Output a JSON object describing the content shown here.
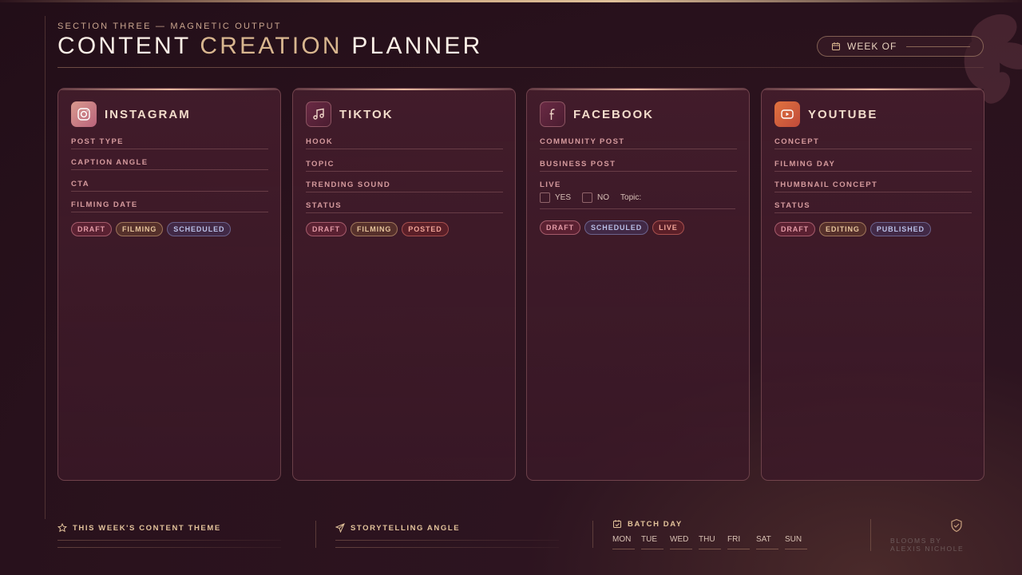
{
  "header": {
    "kicker": "SECTION THREE — MAGNETIC OUTPUT",
    "title_part1": "CONTENT",
    "title_part2": "CREATION",
    "title_part3": "PLANNER",
    "week_label": "WEEK OF"
  },
  "colors": {
    "background": "#2a121d",
    "accent_gold": "#d8b68f",
    "accent_rose": "#d59a9d"
  },
  "cards": [
    {
      "platform": "INSTAGRAM",
      "icon": "instagram-icon",
      "fields": [
        "POST TYPE",
        "CAPTION ANGLE",
        "CTA",
        "FILMING DATE"
      ],
      "tags": [
        "DRAFT",
        "FILMING",
        "SCHEDULED"
      ]
    },
    {
      "platform": "TIKTOK",
      "icon": "music-note-icon",
      "fields": [
        "HOOK",
        "TOPIC",
        "TRENDING SOUND",
        "STATUS"
      ],
      "tags": [
        "DRAFT",
        "FILMING",
        "POSTED"
      ]
    },
    {
      "platform": "FACEBOOK",
      "icon": "facebook-icon",
      "fields": [
        "COMMUNITY POST",
        "BUSINESS POST",
        "LIVE"
      ],
      "live_options": {
        "yes": "YES",
        "no": "NO",
        "topic": "Topic:"
      },
      "tags": [
        "DRAFT",
        "SCHEDULED",
        "LIVE"
      ]
    },
    {
      "platform": "YOUTUBE",
      "icon": "play-icon",
      "fields": [
        "CONCEPT",
        "FILMING DAY",
        "THUMBNAIL CONCEPT",
        "STATUS"
      ],
      "tags": [
        "DRAFT",
        "EDITING",
        "PUBLISHED"
      ]
    }
  ],
  "footer": {
    "theme_label": "THIS WEEK'S CONTENT THEME",
    "story_label": "STORYTELLING ANGLE",
    "batch_label": "BATCH DAY",
    "days": [
      "MON",
      "TUE",
      "WED",
      "THU",
      "FRI",
      "SAT",
      "SUN"
    ],
    "brand_line1": "BLOOMS BY",
    "brand_line2": "ALEXIS NICHOLE"
  }
}
